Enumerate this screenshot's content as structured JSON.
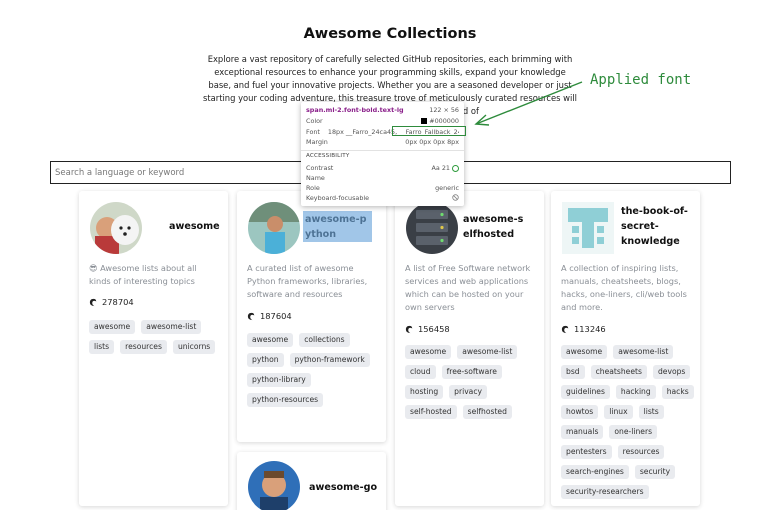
{
  "page": {
    "title": "Awesome Collections",
    "intro": "Explore a vast repository of carefully selected GitHub repositories, each brimming with exceptional resources to enhance your programming skills, expand your knowledge base, and fuel your innovative projects. Whether you are a seasoned developer or just starting your coding adventure, this treasure trove of meticulously curated resources will equip you with t… in the dynamic world of"
  },
  "search": {
    "placeholder": "Search a language or keyword"
  },
  "cards": [
    {
      "title": "awesome",
      "desc": "😎 Awesome lists about all kinds of interesting topics",
      "stars": "278704",
      "tags": [
        "awesome",
        "awesome-list",
        "lists",
        "resources",
        "unicorns"
      ]
    },
    {
      "title": "awesome-python",
      "desc": "A curated list of awesome Python frameworks, libraries, software and resources",
      "stars": "187604",
      "tags": [
        "awesome",
        "collections",
        "python",
        "python-framework",
        "python-library",
        "python-resources"
      ]
    },
    {
      "title": "awesome-selfhosted",
      "desc": "A list of Free Software network services and web applications which can be hosted on your own servers",
      "stars": "156458",
      "tags": [
        "awesome",
        "awesome-list",
        "cloud",
        "free-software",
        "hosting",
        "privacy",
        "self-hosted",
        "selfhosted"
      ]
    },
    {
      "title": "the-book-of-secret-knowledge",
      "desc": "A collection of inspiring lists, manuals, cheatsheets, blogs, hacks, one-liners, cli/web tools and more.",
      "stars": "113246",
      "tags": [
        "awesome",
        "awesome-list",
        "bsd",
        "cheatsheets",
        "devops",
        "guidelines",
        "hacking",
        "hacks",
        "howtos",
        "linux",
        "lists",
        "manuals",
        "one-liners",
        "pentesters",
        "resources",
        "search-engines",
        "security",
        "security-researchers"
      ]
    },
    {
      "title": "awesome-go"
    }
  ],
  "inspector": {
    "selector": "span.ml-2.font-bold.text-lg",
    "size": "122 × 56",
    "color_label": "Color",
    "color_value": "#000000",
    "font_label": "Font",
    "font_value": "18px __Farro_24ca45, __Farro_Fallback_24...",
    "margin_label": "Margin",
    "margin_value": "0px 0px 0px 8px",
    "accessibility_header": "ACCESSIBILITY",
    "contrast_label": "Contrast",
    "contrast_value": "Aa 21",
    "name_label": "Name",
    "name_value": "",
    "role_label": "Role",
    "role_value": "generic",
    "focusable_label": "Keyboard-focusable"
  },
  "annotation": {
    "label": "Applied font",
    "color": "#2e8b3c"
  }
}
